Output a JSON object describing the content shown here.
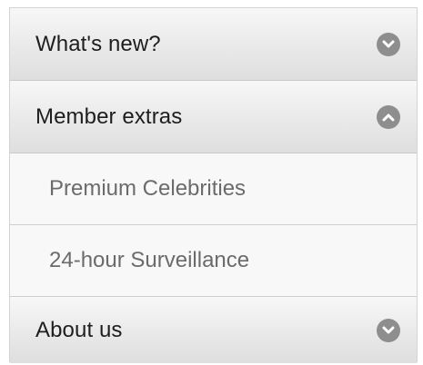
{
  "accordion": {
    "sections": [
      {
        "label": "What's new?",
        "state": "collapsed",
        "icon": "chevron-down-icon"
      },
      {
        "label": "Member extras",
        "state": "expanded",
        "icon": "chevron-up-icon",
        "items": [
          {
            "label": "Premium Celebrities"
          },
          {
            "label": "24-hour Surveillance"
          }
        ]
      },
      {
        "label": "About us",
        "state": "collapsed",
        "icon": "chevron-down-icon"
      }
    ]
  },
  "colors": {
    "header_gradient_top": "#f7f7f7",
    "header_gradient_bottom": "#dedede",
    "icon_circle": "#8e8e8e",
    "sub_item_text": "#6b6b6b"
  }
}
